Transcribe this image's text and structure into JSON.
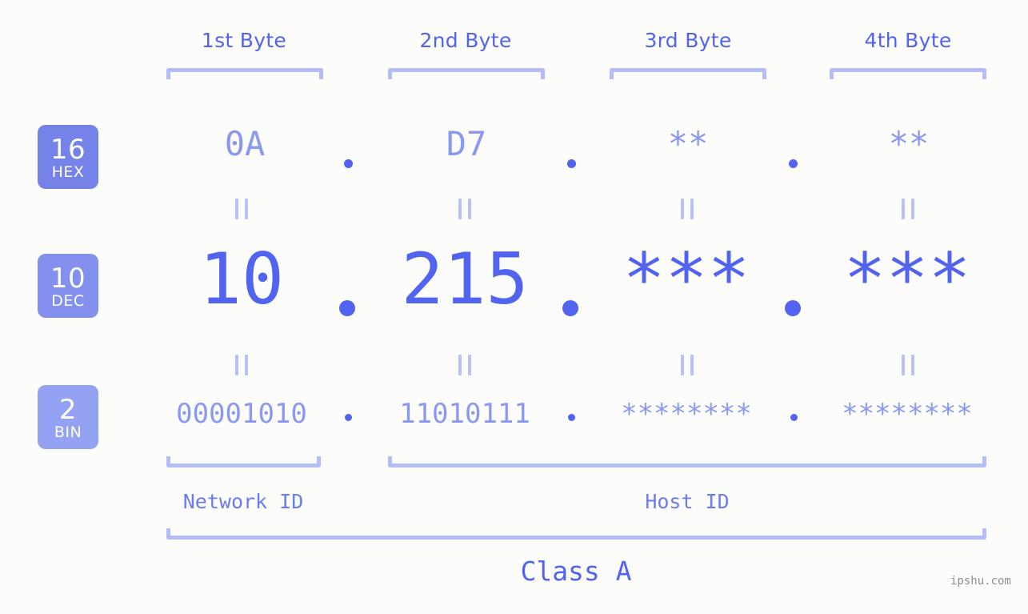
{
  "page": {
    "background_color": "#fcfdfa",
    "accent_color": "#5163ef",
    "accent_light_color": "#8b98f2",
    "bracket_color": "#b4bcf7",
    "watermark": "ipshu.com"
  },
  "byte_headers": [
    {
      "label": "1st Byte"
    },
    {
      "label": "2nd Byte"
    },
    {
      "label": "3rd Byte"
    },
    {
      "label": "4th Byte"
    }
  ],
  "bases": [
    {
      "number": "16",
      "name": "HEX",
      "color": "#7583e8"
    },
    {
      "number": "10",
      "name": "DEC",
      "color": "#8490ee"
    },
    {
      "number": "2",
      "name": "BIN",
      "color": "#93a2f3"
    }
  ],
  "rows": {
    "hex": {
      "values": [
        "0A",
        "D7",
        "**",
        "**"
      ]
    },
    "dec": {
      "values": [
        "10",
        "215",
        "***",
        "***"
      ]
    },
    "bin": {
      "values": [
        "00001010",
        "11010111",
        "********",
        "********"
      ]
    }
  },
  "separators": {
    "hex": ".",
    "dec": ".",
    "bin": "."
  },
  "equality_marks": {
    "symbol": "||",
    "count_per_row": 4
  },
  "id_sections": [
    {
      "label": "Network ID"
    },
    {
      "label": "Host ID"
    }
  ],
  "class": {
    "label": "Class A"
  }
}
